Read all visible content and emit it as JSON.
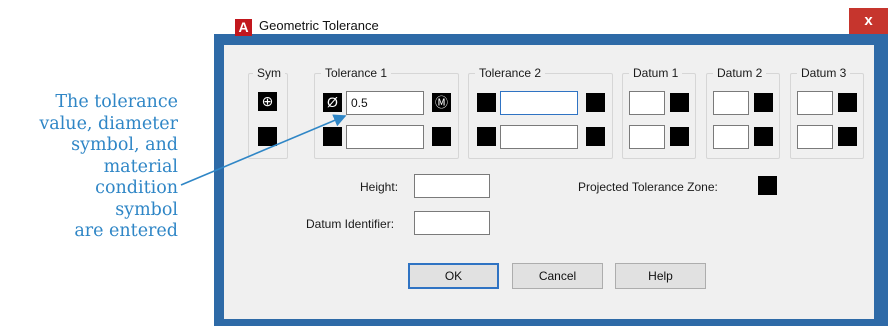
{
  "callout": {
    "lines": [
      "The tolerance",
      "value, diameter",
      "symbol, and",
      "material",
      "condition",
      "symbol",
      "are entered"
    ]
  },
  "dialog": {
    "title": "Geometric Tolerance",
    "close_label": "x",
    "app_icon_letter": "A",
    "groups": {
      "sym": "Sym",
      "tolerance1": "Tolerance 1",
      "tolerance2": "Tolerance 2",
      "datum1": "Datum 1",
      "datum2": "Datum 2",
      "datum3": "Datum 3"
    },
    "sym_glyph": "⊕",
    "diameter_glyph": "Ø",
    "mmc_glyph": "Ⓜ",
    "tolerance1_value": "0.5",
    "height_label": "Height:",
    "datum_identifier_label": "Datum Identifier:",
    "projected_zone_label": "Projected Tolerance Zone:",
    "buttons": {
      "ok": "OK",
      "cancel": "Cancel",
      "help": "Help"
    }
  },
  "colors": {
    "accent": "#2f86c6",
    "frame": "#2e6aa7",
    "close": "#c6352d",
    "brand": "#c2171d"
  }
}
